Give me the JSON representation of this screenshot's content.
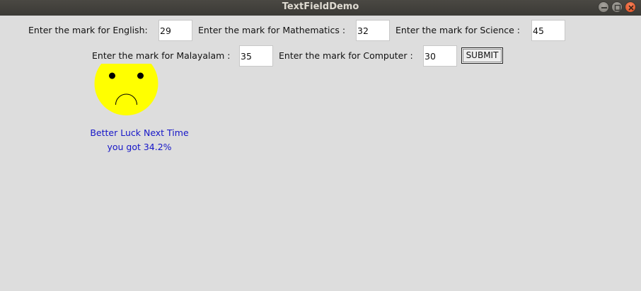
{
  "window": {
    "title": "TextFieldDemo"
  },
  "form": {
    "english": {
      "label": "Enter the mark for English:",
      "value": "29"
    },
    "mathematics": {
      "label": "Enter the mark for Mathematics :",
      "value": "32"
    },
    "science": {
      "label": "Enter the mark for Science :",
      "value": "45"
    },
    "malayalam": {
      "label": "Enter the mark for Malayalam :",
      "value": "35"
    },
    "computer": {
      "label": "Enter the mark for Computer :",
      "value": "30"
    },
    "submit_label": "SUBMIT"
  },
  "result": {
    "face_icon": "sad-face-icon",
    "face_color": "#ffff00",
    "message": "Better Luck Next Time",
    "score": "you got 34.2%",
    "text_color": "#1616c8"
  }
}
